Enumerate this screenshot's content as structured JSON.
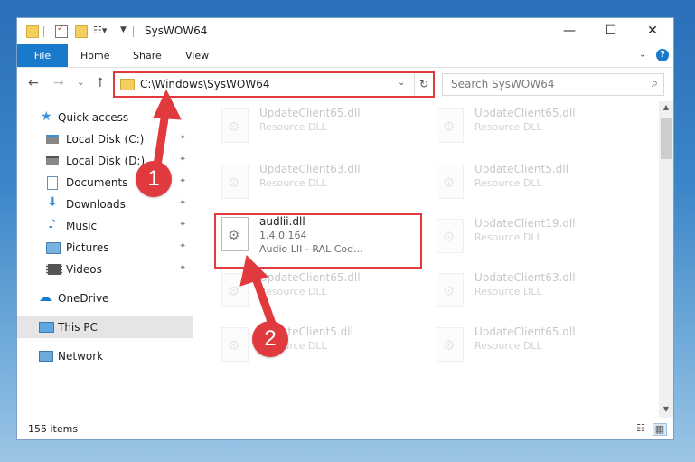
{
  "window": {
    "title": "SysWOW64",
    "quick_access_toolbar": [
      "folder-icon",
      "properties-check-icon",
      "new-folder-icon",
      "customize-icon"
    ],
    "controls": {
      "minimize": "—",
      "maximize": "☐",
      "close": "✕"
    }
  },
  "ribbon": {
    "tabs": [
      "File",
      "Home",
      "Share",
      "View"
    ],
    "expand_chevron": "⌄",
    "help": "?"
  },
  "navbar": {
    "back": "←",
    "forward": "→",
    "recent": "⌄",
    "up": "↑",
    "address": "C:\\Windows\\SysWOW64",
    "address_dropdown": "⌄",
    "refresh": "↻",
    "search_placeholder": "Search SysWOW64",
    "search_icon": "⌕"
  },
  "sidebar": {
    "items": [
      {
        "label": "Quick access",
        "icon": "star-icon",
        "pinned": false,
        "selected": false
      },
      {
        "label": "Local Disk (C:)",
        "icon": "drive-icon",
        "pinned": true,
        "selected": false
      },
      {
        "label": "Local Disk (D:)",
        "icon": "drive-icon",
        "pinned": true,
        "selected": false
      },
      {
        "label": "Documents",
        "icon": "documents-icon",
        "pinned": true,
        "selected": false
      },
      {
        "label": "Downloads",
        "icon": "downloads-icon",
        "pinned": true,
        "selected": false
      },
      {
        "label": "Music",
        "icon": "music-icon",
        "pinned": true,
        "selected": false
      },
      {
        "label": "Pictures",
        "icon": "pictures-icon",
        "pinned": true,
        "selected": false
      },
      {
        "label": "Videos",
        "icon": "videos-icon",
        "pinned": true,
        "selected": false
      },
      {
        "label": "OneDrive",
        "icon": "cloud-icon",
        "pinned": false,
        "selected": false
      },
      {
        "label": "This PC",
        "icon": "computer-icon",
        "pinned": false,
        "selected": true
      },
      {
        "label": "Network",
        "icon": "network-icon",
        "pinned": false,
        "selected": false
      }
    ],
    "pin_glyph": "📌"
  },
  "files": [
    {
      "name": "UpdateClient65.dll",
      "desc": "Resource DLL",
      "faded": true
    },
    {
      "name": "UpdateClient65.dll",
      "desc": "Resource DLL",
      "faded": true
    },
    {
      "name": "UpdateClient63.dll",
      "desc": "Resource DLL",
      "faded": true
    },
    {
      "name": "UpdateClient5.dll",
      "desc": "Resource DLL",
      "faded": true
    },
    {
      "name": "audlii.dll",
      "desc": "1.4.0.164",
      "extra": "Audio LII - RAL Cod...",
      "faded": false,
      "highlighted": true
    },
    {
      "name": "UpdateClient19.dll",
      "desc": "Resource DLL",
      "faded": true
    },
    {
      "name": "UpdateClient65.dll",
      "desc": "Resource DLL",
      "faded": true
    },
    {
      "name": "UpdateClient63.dll",
      "desc": "Resource DLL",
      "faded": true
    },
    {
      "name": "UpdateClient5.dll",
      "desc": "Resource DLL",
      "faded": true
    },
    {
      "name": "UpdateClient65.dll",
      "desc": "Resource DLL",
      "faded": true
    }
  ],
  "status": {
    "item_count": "155 items"
  },
  "callouts": [
    "1",
    "2"
  ],
  "colors": {
    "accent": "#1979ca",
    "highlight_red": "#e0393e"
  }
}
